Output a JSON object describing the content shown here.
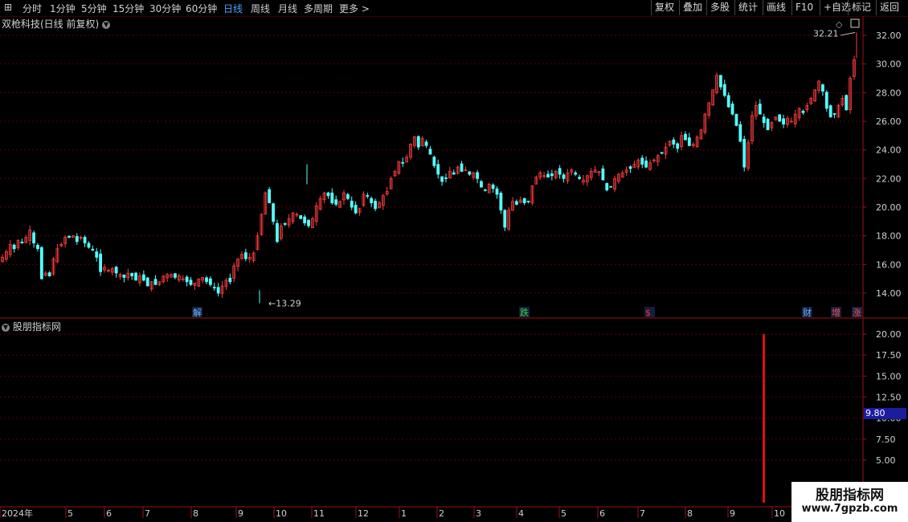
{
  "toolbar": {
    "periods": [
      "分时",
      "1分钟",
      "5分钟",
      "15分钟",
      "30分钟",
      "60分钟",
      "日线",
      "周线",
      "月线",
      "多周期",
      "更多 >"
    ],
    "active_period": "日线",
    "right_buttons": [
      "复权",
      "叠加",
      "多股",
      "统计",
      "画线",
      "F10",
      "+自选",
      "返回"
    ],
    "right_extra": "标记"
  },
  "stock_title": "双枪科技(日线 前复权)",
  "indicator_title": "股朋指标网",
  "price_axis": [
    "32.00",
    "30.00",
    "28.00",
    "26.00",
    "24.00",
    "22.00",
    "20.00",
    "18.00",
    "16.00",
    "14.00"
  ],
  "indicator_axis": [
    "20.00",
    "17.50",
    "15.00",
    "12.50",
    "10.00",
    "7.50",
    "5.00"
  ],
  "current_value": "9.80",
  "high_label": "32.21",
  "low_label": "13.29",
  "time_axis": [
    "2024年",
    "5",
    "6",
    "7",
    "8",
    "9",
    "10",
    "11",
    "12",
    "1",
    "2",
    "3",
    "4",
    "5",
    "6",
    "7",
    "8",
    "9",
    "10"
  ],
  "event_marks": [
    {
      "text": "解",
      "color": "#6fb6ff"
    },
    {
      "text": "跌",
      "color": "#3ad83a"
    },
    {
      "text": "$",
      "color": "#ff3030"
    },
    {
      "text": "财",
      "color": "#6fb6ff"
    },
    {
      "text": "增",
      "color": "#ff5050"
    },
    {
      "text": "涨",
      "color": "#ff5050"
    }
  ],
  "colors": {
    "up": "#ff3c3c",
    "down": "#54ffff",
    "grid": "#5a0000",
    "axis": "#a01010"
  },
  "watermark": {
    "line1": "股朋指标网",
    "line2": "www.7gpzb.com"
  },
  "chart_data": {
    "type": "candlestick",
    "ylim": [
      13,
      33
    ],
    "closes": [
      16.5,
      16.9,
      17.4,
      17.1,
      17.7,
      17.5,
      17.9,
      18.4,
      17.5,
      17.1,
      15.0,
      15.4,
      15.2,
      16.4,
      17.1,
      17.4,
      17.9,
      17.9,
      18.0,
      17.6,
      17.9,
      17.5,
      17.2,
      17.0,
      16.5,
      15.5,
      15.8,
      15.6,
      15.7,
      15.4,
      15.3,
      15.1,
      15.4,
      15.2,
      14.9,
      15.2,
      14.9,
      14.5,
      14.8,
      14.6,
      14.8,
      15.2,
      15.3,
      15.3,
      15.1,
      15.2,
      15.0,
      14.8,
      14.6,
      14.7,
      15.0,
      15.1,
      14.8,
      14.6,
      14.4,
      14.0,
      14.5,
      14.9,
      14.8,
      15.9,
      16.4,
      16.7,
      16.4,
      16.5,
      16.8,
      18.0,
      19.5,
      21.0,
      20.3,
      19.0,
      17.6,
      18.7,
      18.8,
      19.2,
      19.6,
      19.5,
      19.2,
      18.9,
      18.7,
      19.2,
      20.1,
      20.6,
      21.0,
      20.8,
      20.3,
      20.2,
      20.4,
      21.0,
      20.6,
      20.0,
      19.6,
      19.9,
      20.9,
      20.8,
      20.3,
      19.9,
      20.3,
      20.8,
      21.1,
      22.0,
      22.5,
      23.2,
      23.1,
      23.5,
      24.4,
      24.9,
      24.2,
      24.8,
      24.3,
      23.7,
      22.9,
      22.3,
      21.8,
      22.0,
      22.5,
      22.3,
      22.8,
      22.5,
      22.6,
      22.3,
      22.4,
      22.0,
      21.4,
      21.2,
      21.6,
      21.3,
      20.9,
      19.8,
      18.6,
      19.8,
      20.4,
      20.2,
      20.5,
      20.3,
      20.4,
      21.5,
      22.1,
      22.4,
      22.2,
      22.1,
      22.2,
      22.5,
      22.3,
      22.0,
      22.4,
      22.6,
      22.3,
      22.0,
      21.9,
      22.2,
      22.5,
      22.6,
      22.5,
      21.9,
      21.2,
      21.4,
      22.0,
      22.3,
      22.4,
      22.6,
      22.7,
      23.0,
      23.3,
      23.0,
      22.8,
      23.1,
      23.3,
      23.6,
      23.8,
      24.2,
      24.6,
      24.4,
      24.1,
      25.0,
      24.7,
      24.3,
      24.4,
      24.9,
      25.4,
      26.5,
      27.3,
      28.2,
      29.2,
      28.4,
      27.8,
      27.0,
      26.5,
      25.7,
      24.6,
      22.8,
      24.5,
      26.4,
      27.1,
      26.5,
      25.9,
      25.4,
      25.9,
      26.3,
      26.0,
      25.8,
      26.2,
      26.0,
      26.5,
      26.9,
      26.6,
      27.1,
      27.6,
      28.2,
      28.8,
      28.1,
      26.9,
      26.3,
      26.5,
      27.1,
      27.6,
      26.8,
      29.0,
      30.3
    ]
  }
}
